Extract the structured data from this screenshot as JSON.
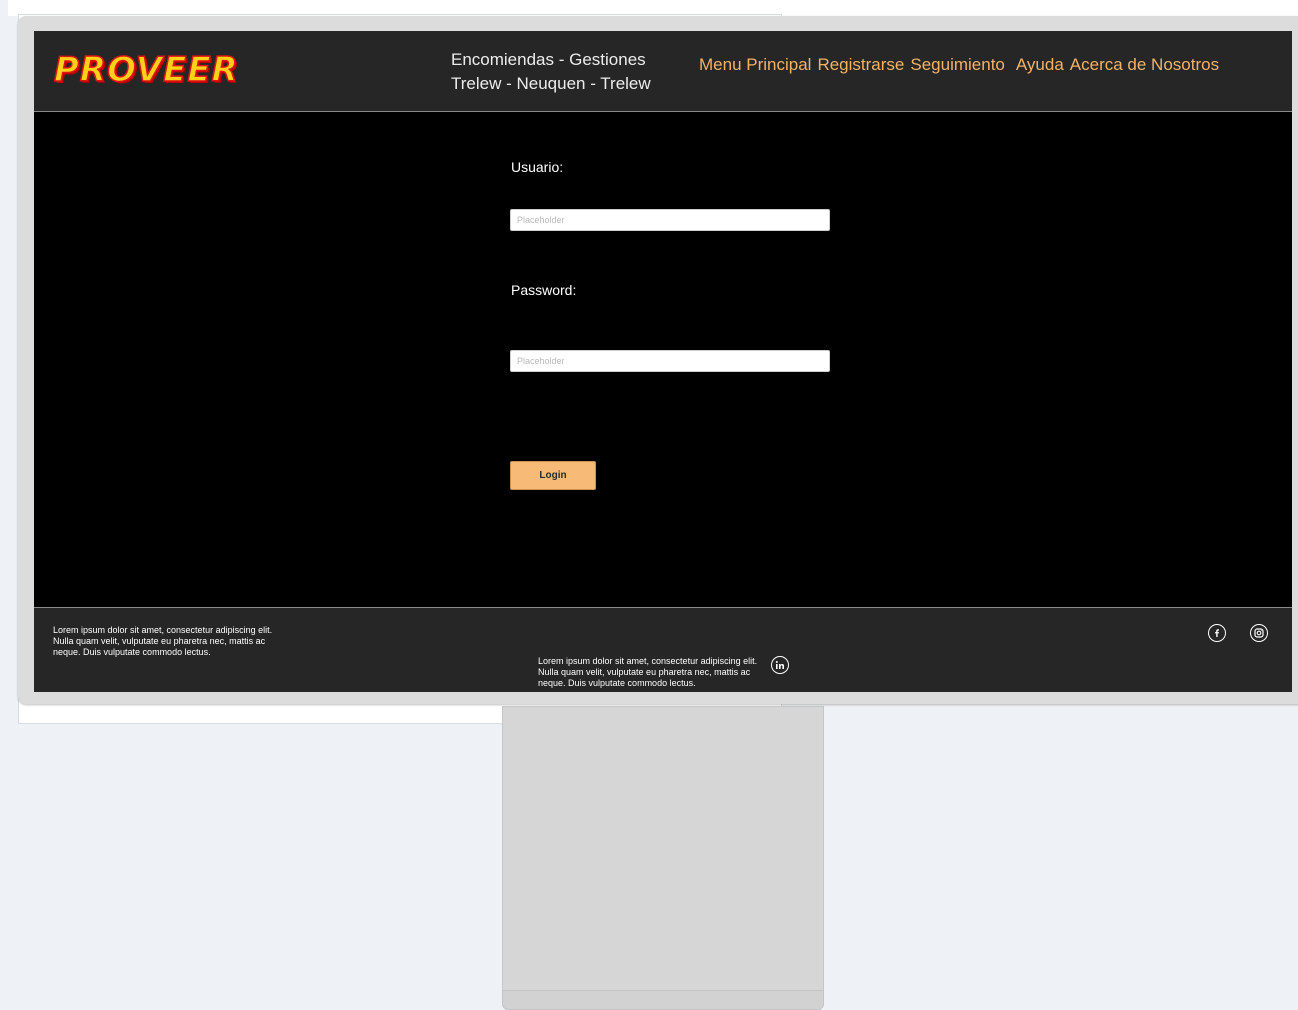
{
  "header": {
    "logo_text": "PROVEER",
    "tagline_line1": "Encomiendas - Gestiones",
    "tagline_line2": "Trelew - Neuquen - Trelew",
    "nav": [
      "Menu Principal",
      "Registrarse",
      "Seguimiento",
      "Ayuda",
      "Acerca de Nosotros"
    ]
  },
  "login_form": {
    "username_label": "Usuario:",
    "username_placeholder": "Placeholder",
    "password_label": "Password:",
    "password_placeholder": "Placeholder",
    "login_button": "Login"
  },
  "footer": {
    "text_left": "Lorem ipsum dolor sit amet, consectetur adipiscing elit. Nulla quam velit, vulputate eu pharetra nec, mattis ac neque. Duis vulputate commodo lectus.",
    "text_center": "Lorem ipsum dolor sit amet, consectetur adipiscing elit. Nulla quam velit, vulputate eu pharetra nec, mattis ac neque. Duis vulputate commodo lectus.",
    "social_icons": [
      "facebook-icon",
      "instagram-icon",
      "linkedin-icon"
    ]
  },
  "colors": {
    "nav_link": "#f3b266",
    "login_button": "#f8bb77",
    "header_bg": "#262626",
    "screen_bg": "#000000",
    "logo_fill": "#ffd21a",
    "logo_stroke": "#e01414"
  }
}
